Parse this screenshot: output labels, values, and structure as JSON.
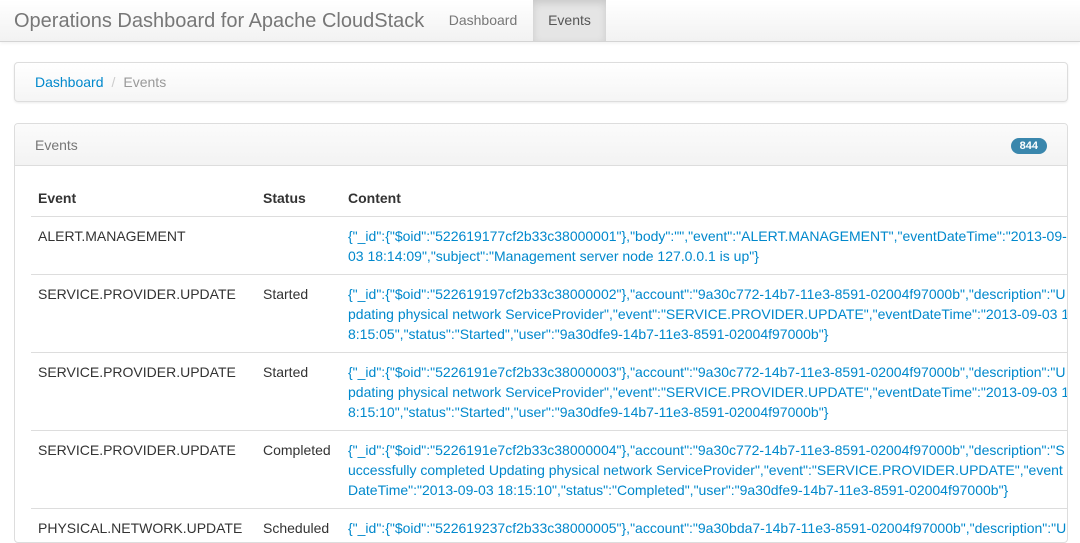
{
  "navbar": {
    "brand": "Operations Dashboard for Apache CloudStack",
    "tabs": [
      {
        "label": "Dashboard",
        "active": false
      },
      {
        "label": "Events",
        "active": true
      }
    ]
  },
  "breadcrumb": {
    "link": "Dashboard",
    "separator": "/",
    "current": "Events"
  },
  "panel": {
    "title": "Events",
    "count_badge": "844"
  },
  "table": {
    "headers": [
      "Event",
      "Status",
      "Content"
    ],
    "rows": [
      {
        "event": "ALERT.MANAGEMENT",
        "status": "",
        "content": "{\"_id\":{\"$oid\":\"522619177cf2b33c38000001\"},\"body\":\"\",\"event\":\"ALERT.MANAGEMENT\",\"eventDateTime\":\"2013-09-03 18:14:09\",\"subject\":\"Management server node 127.0.0.1 is up\"}"
      },
      {
        "event": "SERVICE.PROVIDER.UPDATE",
        "status": "Started",
        "content": "{\"_id\":{\"$oid\":\"522619197cf2b33c38000002\"},\"account\":\"9a30c772-14b7-11e3-8591-02004f97000b\",\"description\":\"Updating physical network ServiceProvider\",\"event\":\"SERVICE.PROVIDER.UPDATE\",\"eventDateTime\":\"2013-09-03 18:15:05\",\"status\":\"Started\",\"user\":\"9a30dfe9-14b7-11e3-8591-02004f97000b\"}"
      },
      {
        "event": "SERVICE.PROVIDER.UPDATE",
        "status": "Started",
        "content": "{\"_id\":{\"$oid\":\"5226191e7cf2b33c38000003\"},\"account\":\"9a30c772-14b7-11e3-8591-02004f97000b\",\"description\":\"Updating physical network ServiceProvider\",\"event\":\"SERVICE.PROVIDER.UPDATE\",\"eventDateTime\":\"2013-09-03 18:15:10\",\"status\":\"Started\",\"user\":\"9a30dfe9-14b7-11e3-8591-02004f97000b\"}"
      },
      {
        "event": "SERVICE.PROVIDER.UPDATE",
        "status": "Completed",
        "content": "{\"_id\":{\"$oid\":\"5226191e7cf2b33c38000004\"},\"account\":\"9a30c772-14b7-11e3-8591-02004f97000b\",\"description\":\"Successfully completed Updating physical network ServiceProvider\",\"event\":\"SERVICE.PROVIDER.UPDATE\",\"eventDateTime\":\"2013-09-03 18:15:10\",\"status\":\"Completed\",\"user\":\"9a30dfe9-14b7-11e3-8591-02004f97000b\"}"
      },
      {
        "event": "PHYSICAL.NETWORK.UPDATE",
        "status": "Scheduled",
        "content": "{\"_id\":{\"$oid\":\"522619237cf2b33c38000005\"},\"account\":\"9a30bda7-14b7-11e3-8591-02004f97000b\",\"description\":\"Updating physical network\"}"
      }
    ]
  },
  "colors": {
    "link": "#0088cc",
    "badge": "#3a87ad",
    "active_tab_bg": "#e5e5e5"
  }
}
